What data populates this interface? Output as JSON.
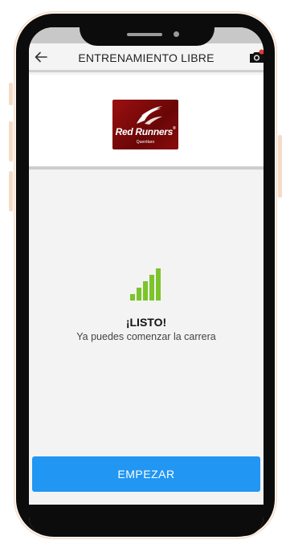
{
  "appbar": {
    "title": "ENTRENAMIENTO LIBRE",
    "back_icon": "arrow-left-icon",
    "camera_icon": "camera-icon",
    "notification_color": "#e53935"
  },
  "logo": {
    "brand": "Red Runners",
    "registered": "®",
    "sub": "Querétaro"
  },
  "status": {
    "title": "¡LISTO!",
    "message": "Ya puedes comenzar la carrera",
    "signal_icon": "signal-bars-icon",
    "signal_color": "#7cc42b"
  },
  "actions": {
    "start_label": "EMPEZAR",
    "start_color": "#2196f3"
  }
}
